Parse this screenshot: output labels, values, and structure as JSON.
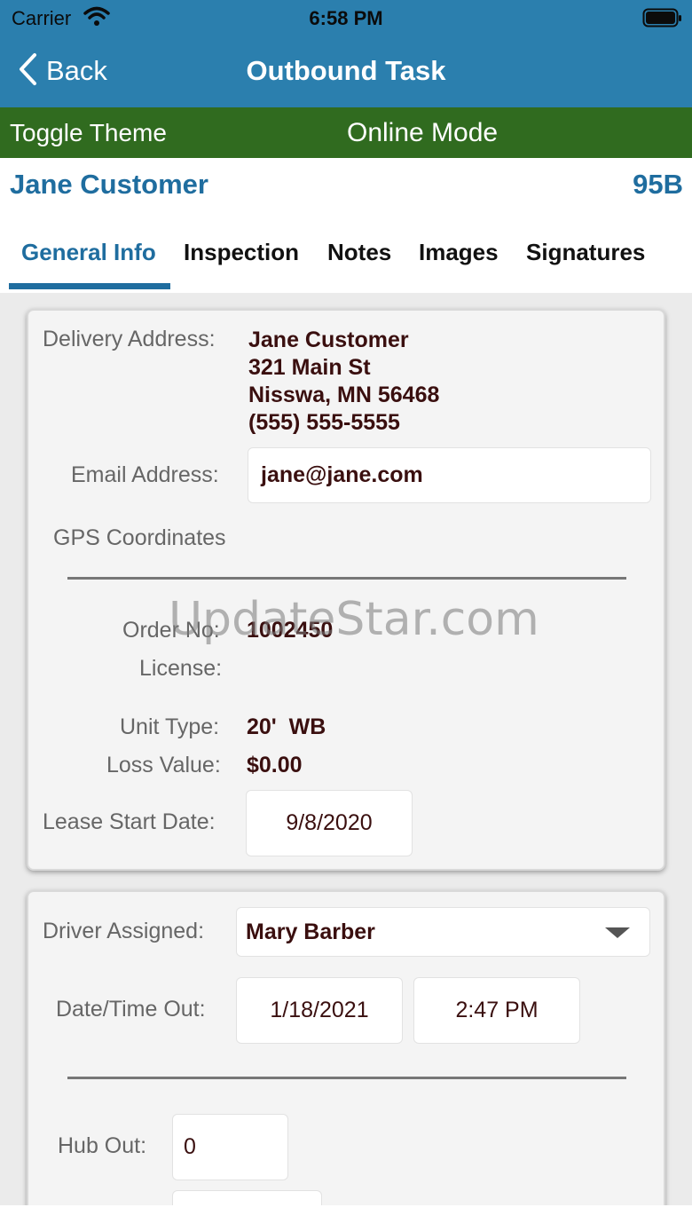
{
  "status_bar": {
    "carrier": "Carrier",
    "time": "6:58 PM",
    "wifi_icon": "wifi-icon",
    "battery_icon": "battery-icon"
  },
  "nav": {
    "back_label": "Back",
    "back_icon": "chevron-left-icon",
    "title": "Outbound Task"
  },
  "mode_bar": {
    "toggle_theme": "Toggle Theme",
    "mode": "Online Mode"
  },
  "header": {
    "customer_name": "Jane Customer",
    "unit_id": "95B"
  },
  "tabs": [
    {
      "label": "General Info",
      "active": true
    },
    {
      "label": "Inspection",
      "active": false
    },
    {
      "label": "Notes",
      "active": false
    },
    {
      "label": "Images",
      "active": false
    },
    {
      "label": "Signatures",
      "active": false
    }
  ],
  "general_info": {
    "delivery_address_label": "Delivery Address:",
    "delivery_address_lines": [
      "Jane Customer",
      "321 Main St",
      "Nisswa, MN 56468",
      "(555) 555-5555"
    ],
    "email_label": "Email Address:",
    "email_value": "jane@jane.com",
    "gps_label": "GPS Coordinates",
    "order_label": "Order No:",
    "order_value": "1002450",
    "license_label": "License:",
    "unit_type_label": "Unit Type:",
    "unit_type_value": "20'  WB",
    "loss_value_label": "Loss Value:",
    "loss_value_value": "$0.00",
    "lease_start_label": "Lease Start Date:",
    "lease_start_value": "9/8/2020"
  },
  "driver_section": {
    "driver_label": "Driver Assigned:",
    "driver_value": "Mary Barber",
    "datetime_label": "Date/Time Out:",
    "date_value": "1/18/2021",
    "time_value": "2:47 PM",
    "hub_out_label": "Hub Out:",
    "hub_out_value": "0"
  },
  "watermark": "UpdateStar.com",
  "colors": {
    "nav_blue": "#2b7fae",
    "mode_green": "#306b1f",
    "accent_blue": "#1f6d9f"
  }
}
